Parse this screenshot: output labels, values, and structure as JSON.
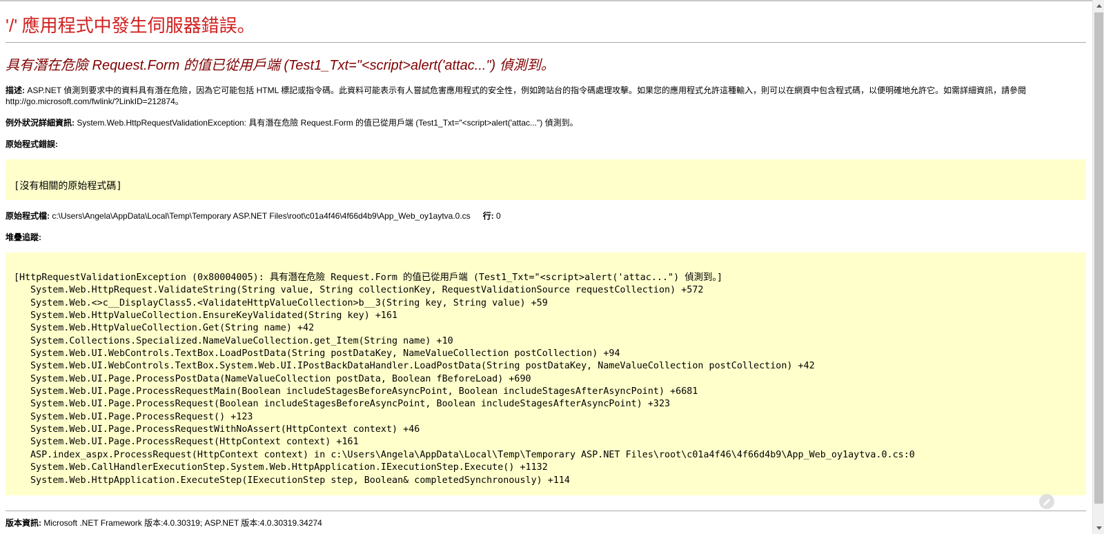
{
  "error_page": {
    "title_app": "'/'",
    "title_rest": " 應用程式中發生伺服器錯誤。",
    "subtitle": "具有潛在危險 Request.Form 的值已從用戶端 (Test1_Txt=\"<script>alert('attac...\") 偵測到。",
    "description_label": "描述:",
    "description_text": " ASP.NET 偵測到要求中的資料具有潛在危險，因為它可能包括 HTML 標記或指令碼。此資料可能表示有人嘗試危害應用程式的安全性，例如跨站台的指令碼處理攻擊。如果您的應用程式允許這種輸入，則可以在網頁中包含程式碼，以便明確地允許它。如需詳細資訊，請參閱 http://go.microsoft.com/fwlink/?LinkID=212874。",
    "exception_label": "例外狀況詳細資訊:",
    "exception_text": " System.Web.HttpRequestValidationException: 具有潛在危險 Request.Form 的值已從用戶端 (Test1_Txt=\"<script>alert('attac...\") 偵測到。",
    "source_error_label": "原始程式錯誤:",
    "no_source": "[沒有相關的原始程式碼]",
    "source_file_label": "原始程式檔:",
    "source_file_path": " c:\\Users\\Angela\\AppData\\Local\\Temp\\Temporary ASP.NET Files\\root\\c01a4f46\\4f66d4b9\\App_Web_oy1aytva.0.cs",
    "line_label": "行:",
    "line_value": " 0",
    "stack_trace_label": "堆疊追蹤:",
    "stack_header": "[HttpRequestValidationException (0x80004005): 具有潛在危險 Request.Form 的值已從用戶端 (Test1_Txt=\"<script>alert('attac...\") 偵測到。]",
    "stack_lines": [
      "System.Web.HttpRequest.ValidateString(String value, String collectionKey, RequestValidationSource requestCollection) +572",
      "System.Web.<>c__DisplayClass5.<ValidateHttpValueCollection>b__3(String key, String value) +59",
      "System.Web.HttpValueCollection.EnsureKeyValidated(String key) +161",
      "System.Web.HttpValueCollection.Get(String name) +42",
      "System.Collections.Specialized.NameValueCollection.get_Item(String name) +10",
      "System.Web.UI.WebControls.TextBox.LoadPostData(String postDataKey, NameValueCollection postCollection) +94",
      "System.Web.UI.WebControls.TextBox.System.Web.UI.IPostBackDataHandler.LoadPostData(String postDataKey, NameValueCollection postCollection) +42",
      "System.Web.UI.Page.ProcessPostData(NameValueCollection postData, Boolean fBeforeLoad) +690",
      "System.Web.UI.Page.ProcessRequestMain(Boolean includeStagesBeforeAsyncPoint, Boolean includeStagesAfterAsyncPoint) +6681",
      "System.Web.UI.Page.ProcessRequest(Boolean includeStagesBeforeAsyncPoint, Boolean includeStagesAfterAsyncPoint) +323",
      "System.Web.UI.Page.ProcessRequest() +123",
      "System.Web.UI.Page.ProcessRequestWithNoAssert(HttpContext context) +46",
      "System.Web.UI.Page.ProcessRequest(HttpContext context) +161",
      "ASP.index_aspx.ProcessRequest(HttpContext context) in c:\\Users\\Angela\\AppData\\Local\\Temp\\Temporary ASP.NET Files\\root\\c01a4f46\\4f66d4b9\\App_Web_oy1aytva.0.cs:0",
      "System.Web.CallHandlerExecutionStep.System.Web.HttpApplication.IExecutionStep.Execute() +1132",
      "System.Web.HttpApplication.ExecuteStep(IExecutionStep step, Boolean& completedSynchronously) +114"
    ],
    "version_label": "版本資訊:",
    "version_text": " Microsoft .NET Framework 版本:4.0.30319; ASP.NET 版本:4.0.30319.34274"
  },
  "colors": {
    "title": "#d02020",
    "subtitle": "#800000",
    "code_background": "#ffffcc"
  },
  "icons": {
    "watermark": "watermark-icon",
    "scroll_up": "scroll-up-arrow-icon",
    "scroll_down": "scroll-down-arrow-icon"
  }
}
